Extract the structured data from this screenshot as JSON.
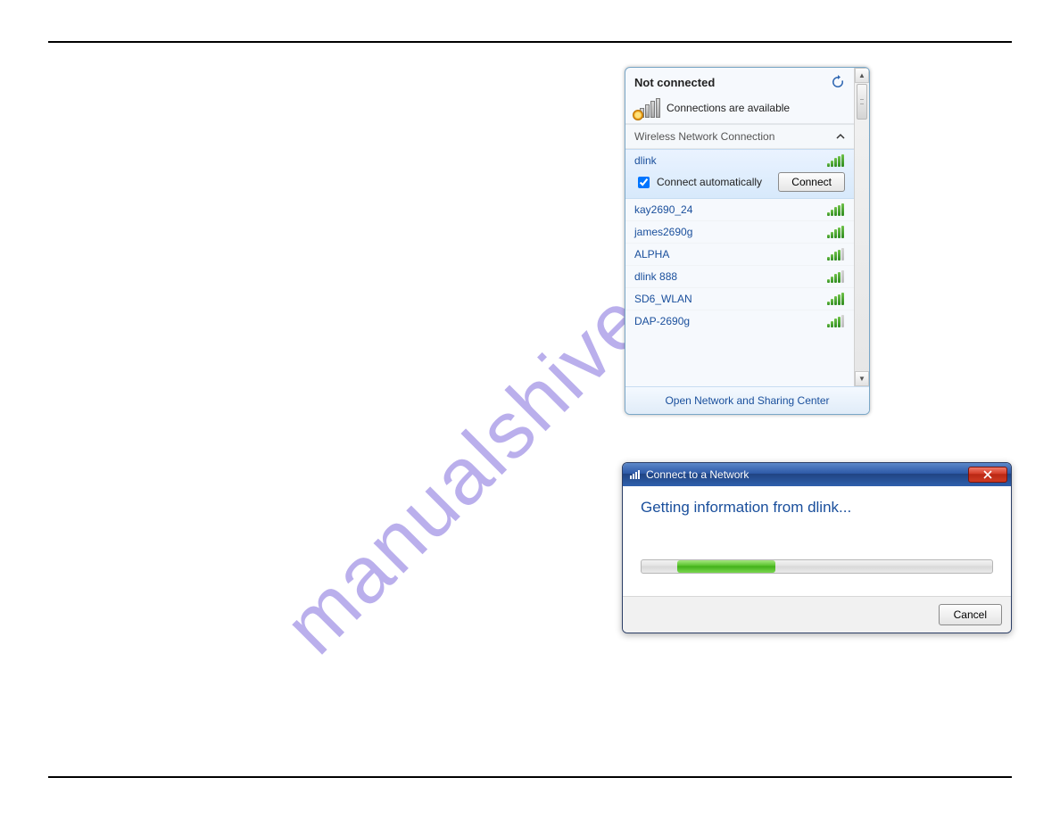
{
  "watermark": "manualshive.com",
  "flyout": {
    "status_title": "Not connected",
    "status_sub": "Connections are available",
    "adapter_label": "Wireless Network Connection",
    "selected": {
      "ssid": "dlink",
      "auto_checkbox_label": "Connect automatically",
      "auto_checked": true,
      "connect_button": "Connect"
    },
    "networks": [
      {
        "ssid": "kay2690_24",
        "bars": 5
      },
      {
        "ssid": "james2690g",
        "bars": 5
      },
      {
        "ssid": "ALPHA",
        "bars": 4
      },
      {
        "ssid": "dlink 888",
        "bars": 4
      },
      {
        "ssid": "SD6_WLAN",
        "bars": 5
      },
      {
        "ssid": "DAP-2690g",
        "bars": 4
      }
    ],
    "footer_link": "Open Network and Sharing Center"
  },
  "dialog": {
    "title": "Connect to a Network",
    "heading": "Getting information from dlink...",
    "cancel_button": "Cancel"
  }
}
